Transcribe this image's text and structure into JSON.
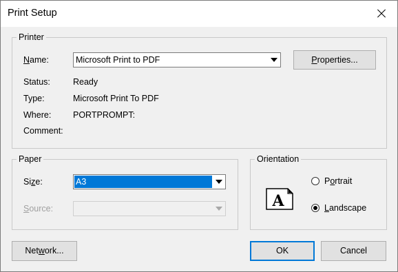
{
  "window": {
    "title": "Print Setup"
  },
  "printer": {
    "legend": "Printer",
    "name_label": "Name:",
    "name_value": "Microsoft Print to PDF",
    "status_label": "Status:",
    "status_value": "Ready",
    "type_label": "Type:",
    "type_value": "Microsoft Print To PDF",
    "where_label": "Where:",
    "where_value": "PORTPROMPT:",
    "comment_label": "Comment:",
    "comment_value": "",
    "properties_button": "Properties..."
  },
  "paper": {
    "legend": "Paper",
    "size_label": "Size:",
    "size_value": "A3",
    "source_label": "Source:",
    "source_value": ""
  },
  "orientation": {
    "legend": "Orientation",
    "portrait_label": "Portrait",
    "landscape_label": "Landscape",
    "selected": "landscape",
    "icon_letter": "A"
  },
  "buttons": {
    "network": "Network...",
    "ok": "OK",
    "cancel": "Cancel"
  },
  "colors": {
    "selection": "#0078d7",
    "background": "#f0f0f0"
  }
}
